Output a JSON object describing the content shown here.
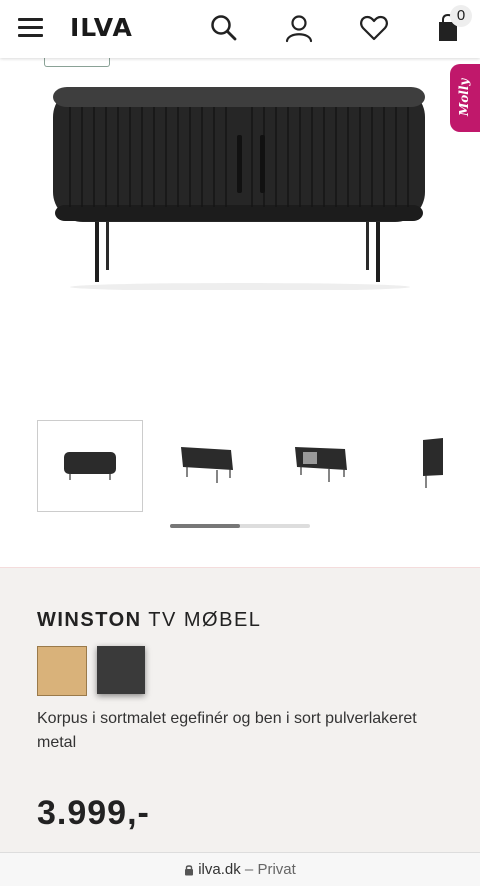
{
  "header": {
    "logo": "ILVA",
    "cart_count": "0"
  },
  "assistant": {
    "label": "Molly"
  },
  "product": {
    "name_bold": "WINSTON",
    "name_rest": "TV MØBEL",
    "description": "Korpus i sortmalet egefinér og ben i sort pulverlakeret metal",
    "price": "3.999,-",
    "swatches": [
      {
        "name": "oak",
        "color": "#d9b27a"
      },
      {
        "name": "black",
        "color": "#3a3a3a"
      }
    ]
  },
  "gallery": {
    "thumbnail_count": 4,
    "active_index": 0,
    "scroll_progress": 0.5
  },
  "browser": {
    "domain": "ilva.dk",
    "separator": "–",
    "mode": "Privat"
  },
  "colors": {
    "assistant_tab": "#c0186b",
    "info_background": "#f3f1ef"
  }
}
